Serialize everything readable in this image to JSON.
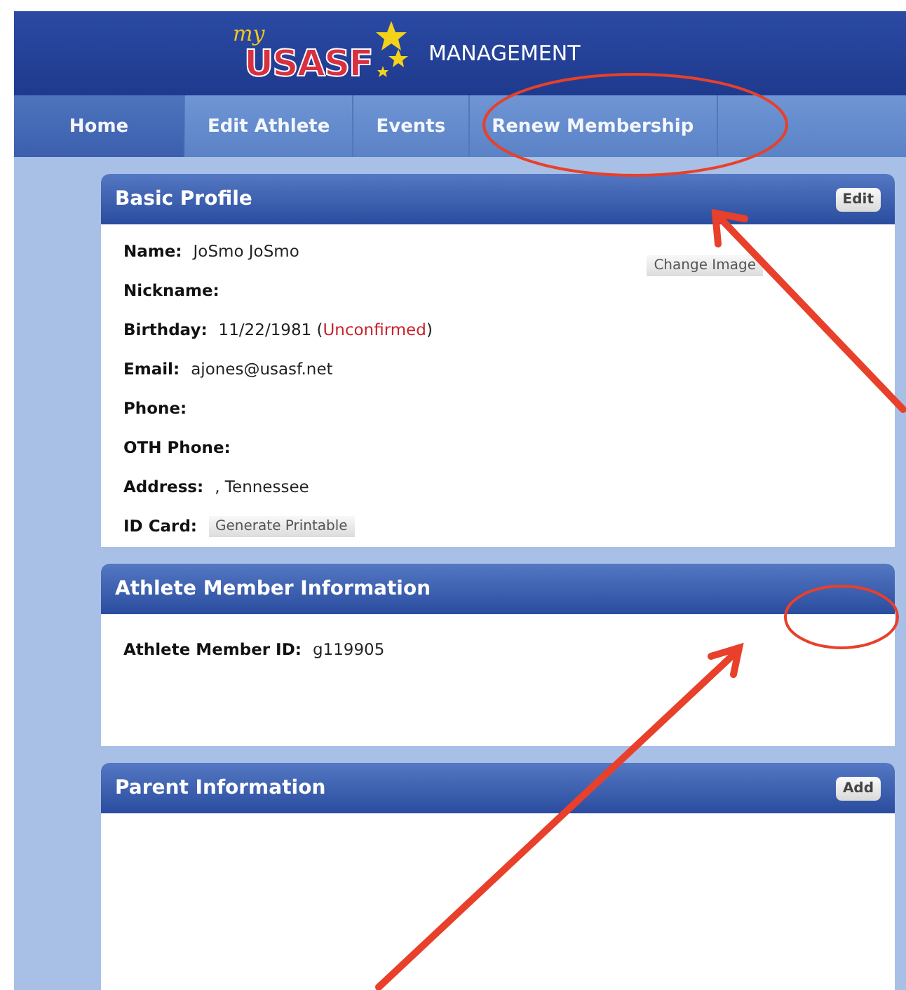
{
  "header": {
    "logo": {
      "script": "my",
      "name": "USASF"
    },
    "title": "MANAGEMENT"
  },
  "tabs": [
    {
      "label": "Home",
      "selected": true
    },
    {
      "label": "Edit Athlete",
      "selected": false
    },
    {
      "label": "Events",
      "selected": false
    },
    {
      "label": "Renew Membership",
      "selected": false
    }
  ],
  "basic_profile": {
    "title": "Basic Profile",
    "action": "Edit",
    "change_image": "Change Image",
    "fields": [
      {
        "kind": "text",
        "label": "Name:",
        "parts": [
          {
            "text": "JoSmo JoSmo",
            "alert": false
          }
        ]
      },
      {
        "kind": "text",
        "label": "Nickname:"
      },
      {
        "kind": "text",
        "label": "Birthday:",
        "parts": [
          {
            "text": "11/22/1981 (",
            "alert": false
          },
          {
            "text": "Unconfirmed",
            "alert": true
          },
          {
            "text": ")",
            "alert": false
          }
        ]
      },
      {
        "kind": "text",
        "label": "Email:",
        "parts": [
          {
            "text": "ajones@usasf.net",
            "alert": false
          }
        ]
      },
      {
        "kind": "text",
        "label": "Phone:"
      },
      {
        "kind": "text",
        "label": "OTH Phone:"
      },
      {
        "kind": "text",
        "label": "Address:",
        "parts": [
          {
            "text": ", Tennessee",
            "alert": false
          }
        ]
      },
      {
        "kind": "button",
        "label": "ID Card:",
        "button": "Generate Printable"
      }
    ]
  },
  "athlete_member": {
    "title": "Athlete Member Information",
    "label": "Athlete Member ID:",
    "value": "g119905"
  },
  "parent_information": {
    "title": "Parent Information",
    "action": "Add"
  }
}
